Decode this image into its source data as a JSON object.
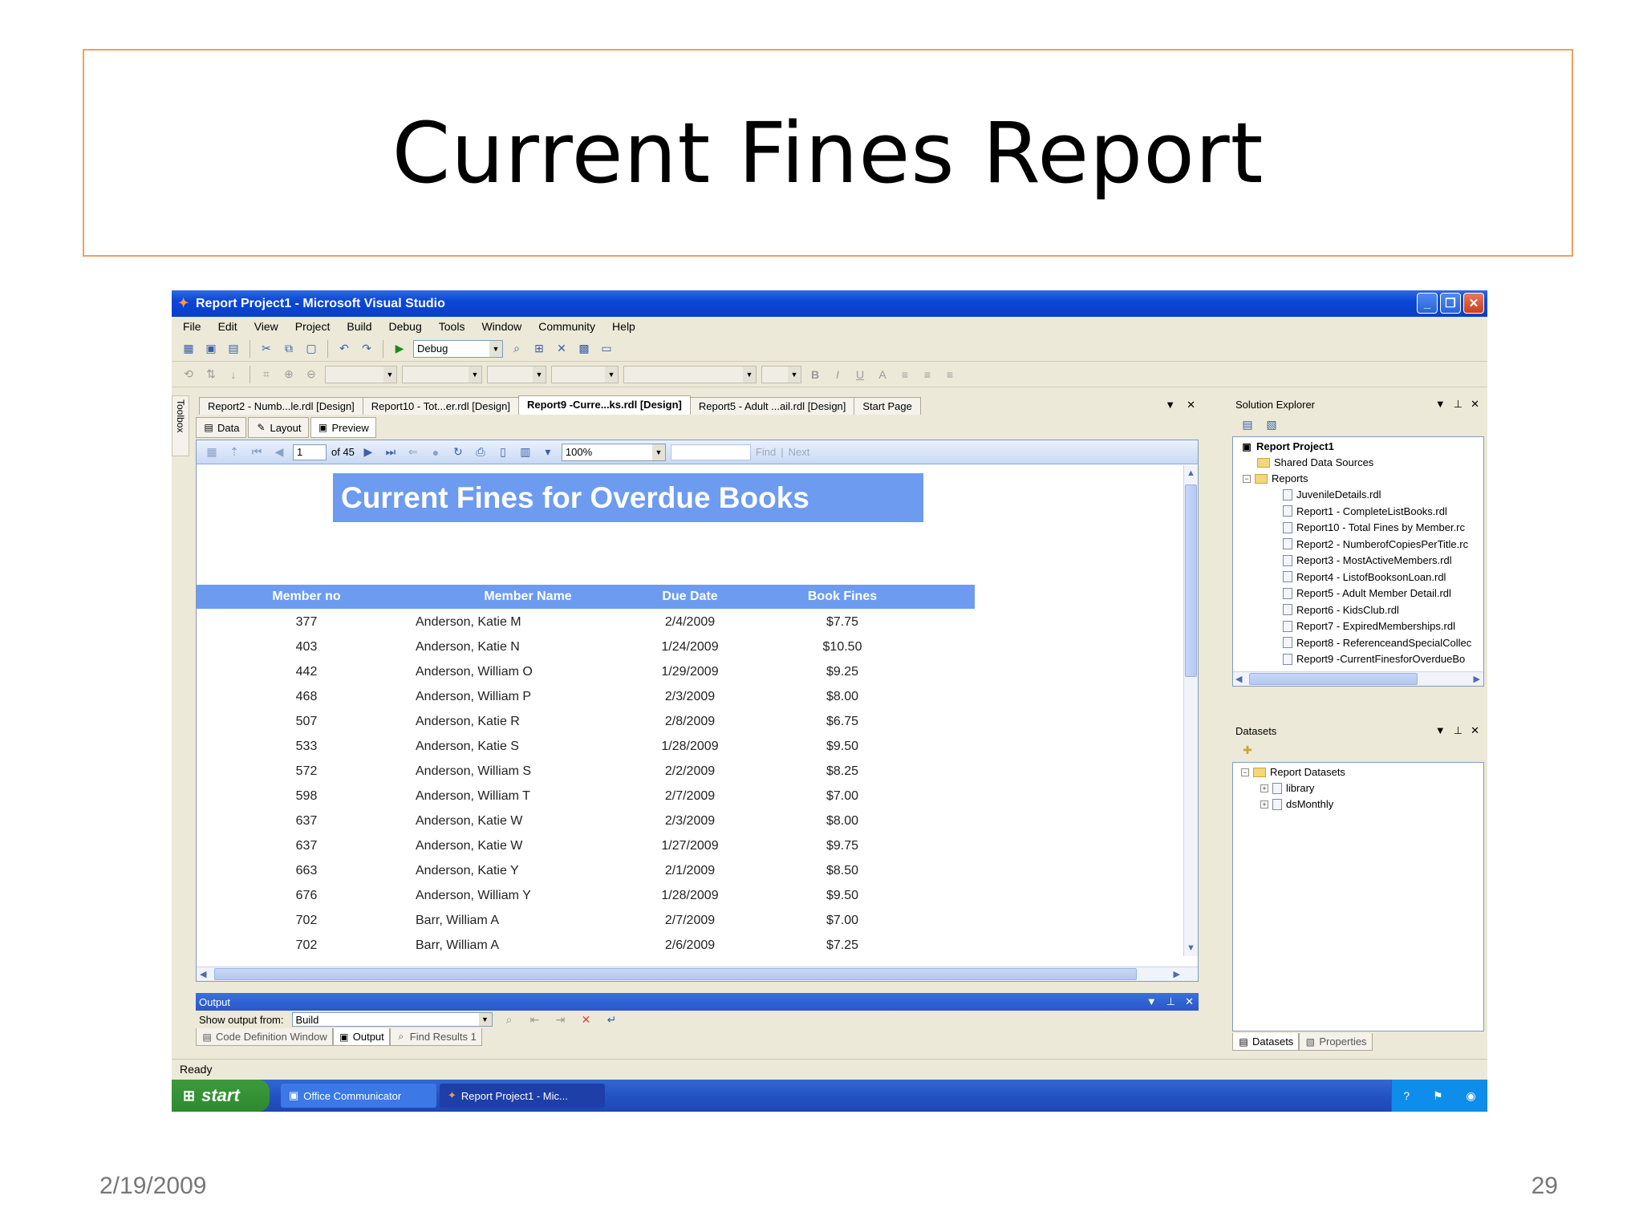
{
  "slide": {
    "title": "Current Fines Report",
    "date": "2/19/2009",
    "page_number": "29"
  },
  "window": {
    "title": "Report Project1 - Microsoft Visual Studio",
    "menu": [
      "File",
      "Edit",
      "View",
      "Project",
      "Build",
      "Debug",
      "Tools",
      "Window",
      "Community",
      "Help"
    ],
    "config_value": "Debug"
  },
  "doc_tabs": [
    "Report2 - Numb...le.rdl [Design]",
    "Report10 - Tot...er.rdl [Design]",
    "Report9 -Curre...ks.rdl [Design]",
    "Report5 - Adult ...ail.rdl [Design]",
    "Start Page"
  ],
  "toolbox_label": "Toolbox",
  "sub_tabs": [
    "Data",
    "Layout",
    "Preview"
  ],
  "viewer": {
    "page": "1",
    "of_pages": "of  45",
    "zoom": "100%",
    "find_label": "Find",
    "sep": "|",
    "next_label": "Next"
  },
  "report": {
    "title": "Current Fines for Overdue Books",
    "columns": [
      "Member no",
      "Member Name",
      "Due Date",
      "Book Fines"
    ],
    "rows": [
      [
        "377",
        "Anderson, Katie  M",
        "2/4/2009",
        "$7.75"
      ],
      [
        "403",
        "Anderson, Katie  N",
        "1/24/2009",
        "$10.50"
      ],
      [
        "442",
        "Anderson, William  O",
        "1/29/2009",
        "$9.25"
      ],
      [
        "468",
        "Anderson, William  P",
        "2/3/2009",
        "$8.00"
      ],
      [
        "507",
        "Anderson, Katie  R",
        "2/8/2009",
        "$6.75"
      ],
      [
        "533",
        "Anderson, Katie  S",
        "1/28/2009",
        "$9.50"
      ],
      [
        "572",
        "Anderson, William  S",
        "2/2/2009",
        "$8.25"
      ],
      [
        "598",
        "Anderson, William  T",
        "2/7/2009",
        "$7.00"
      ],
      [
        "637",
        "Anderson, Katie  W",
        "2/3/2009",
        "$8.00"
      ],
      [
        "637",
        "Anderson, Katie  W",
        "1/27/2009",
        "$9.75"
      ],
      [
        "663",
        "Anderson, Katie  Y",
        "2/1/2009",
        "$8.50"
      ],
      [
        "676",
        "Anderson, William  Y",
        "1/28/2009",
        "$9.50"
      ],
      [
        "702",
        "Barr, William  A",
        "2/7/2009",
        "$7.00"
      ],
      [
        "702",
        "Barr, William  A",
        "2/6/2009",
        "$7.25"
      ]
    ]
  },
  "solution_explorer": {
    "title": "Solution Explorer",
    "project": "Report Project1",
    "shared": "Shared Data Sources",
    "reports_folder": "Reports",
    "files": [
      "JuvenileDetails.rdl",
      "Report1 - CompleteListBooks.rdl",
      "Report10 - Total Fines by Member.rc",
      "Report2 - NumberofCopiesPerTitle.rc",
      "Report3 - MostActiveMembers.rdl",
      "Report4 - ListofBooksonLoan.rdl",
      "Report5 - Adult Member Detail.rdl",
      "Report6 - KidsClub.rdl",
      "Report7 - ExpiredMemberships.rdl",
      "Report8 - ReferenceandSpecialCollec",
      "Report9 -CurrentFinesforOverdueBo"
    ]
  },
  "datasets": {
    "title": "Datasets",
    "root": "Report Datasets",
    "items": [
      "library",
      "dsMonthly"
    ]
  },
  "side_bottom_tabs": [
    "Datasets",
    "Properties"
  ],
  "output": {
    "title": "Output",
    "show_from_label": "Show output from:",
    "show_from_value": "Build"
  },
  "bottom_tabs": [
    "Code Definition Window",
    "Output",
    "Find Results 1"
  ],
  "status": "Ready",
  "taskbar": {
    "start": "start",
    "tasks": [
      "Office Communicator",
      "Report Project1 - Mic..."
    ]
  }
}
